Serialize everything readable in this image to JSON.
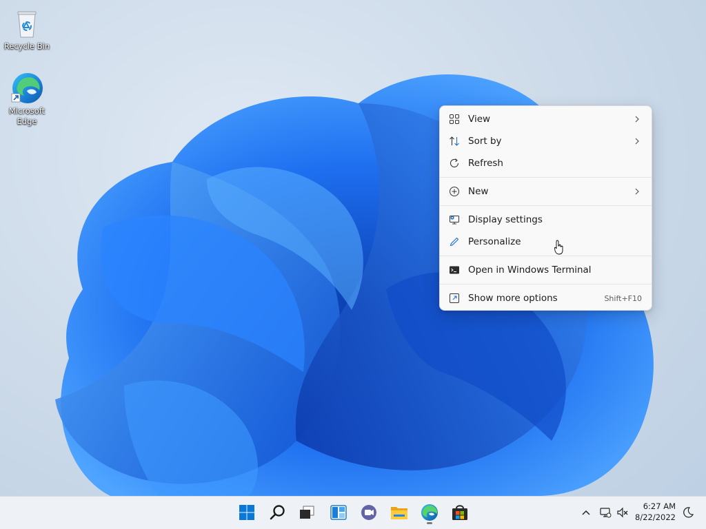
{
  "desktop": {
    "icons": [
      {
        "label": "Recycle Bin",
        "icon": "recycle-bin-icon"
      },
      {
        "label": "Microsoft Edge",
        "icon": "edge-icon"
      }
    ]
  },
  "context_menu": {
    "items": [
      {
        "label": "View",
        "icon": "grid-view-icon",
        "submenu": true
      },
      {
        "label": "Sort by",
        "icon": "sort-icon",
        "submenu": true
      },
      {
        "label": "Refresh",
        "icon": "refresh-icon"
      },
      {
        "label": "New",
        "icon": "plus-circle-icon",
        "submenu": true
      },
      {
        "label": "Display settings",
        "icon": "display-settings-icon"
      },
      {
        "label": "Personalize",
        "icon": "pen-icon"
      },
      {
        "label": "Open in Windows Terminal",
        "icon": "terminal-icon"
      },
      {
        "label": "Show more options",
        "icon": "expand-icon",
        "shortcut": "Shift+F10"
      }
    ]
  },
  "taskbar": {
    "apps": [
      {
        "name": "Start",
        "icon": "windows-start-icon"
      },
      {
        "name": "Search",
        "icon": "search-icon"
      },
      {
        "name": "Task View",
        "icon": "task-view-icon"
      },
      {
        "name": "Widgets",
        "icon": "widgets-icon"
      },
      {
        "name": "Chat",
        "icon": "chat-icon"
      },
      {
        "name": "File Explorer",
        "icon": "folder-icon"
      },
      {
        "name": "Microsoft Edge",
        "icon": "edge-icon",
        "running": true
      },
      {
        "name": "Microsoft Store",
        "icon": "store-icon"
      }
    ],
    "tray": {
      "time": "6:27 AM",
      "date": "8/22/2022"
    }
  },
  "colors": {
    "accent": "#0067c0",
    "bloom": "#1a6fe8",
    "menu_bg": "#f9f9f9"
  }
}
